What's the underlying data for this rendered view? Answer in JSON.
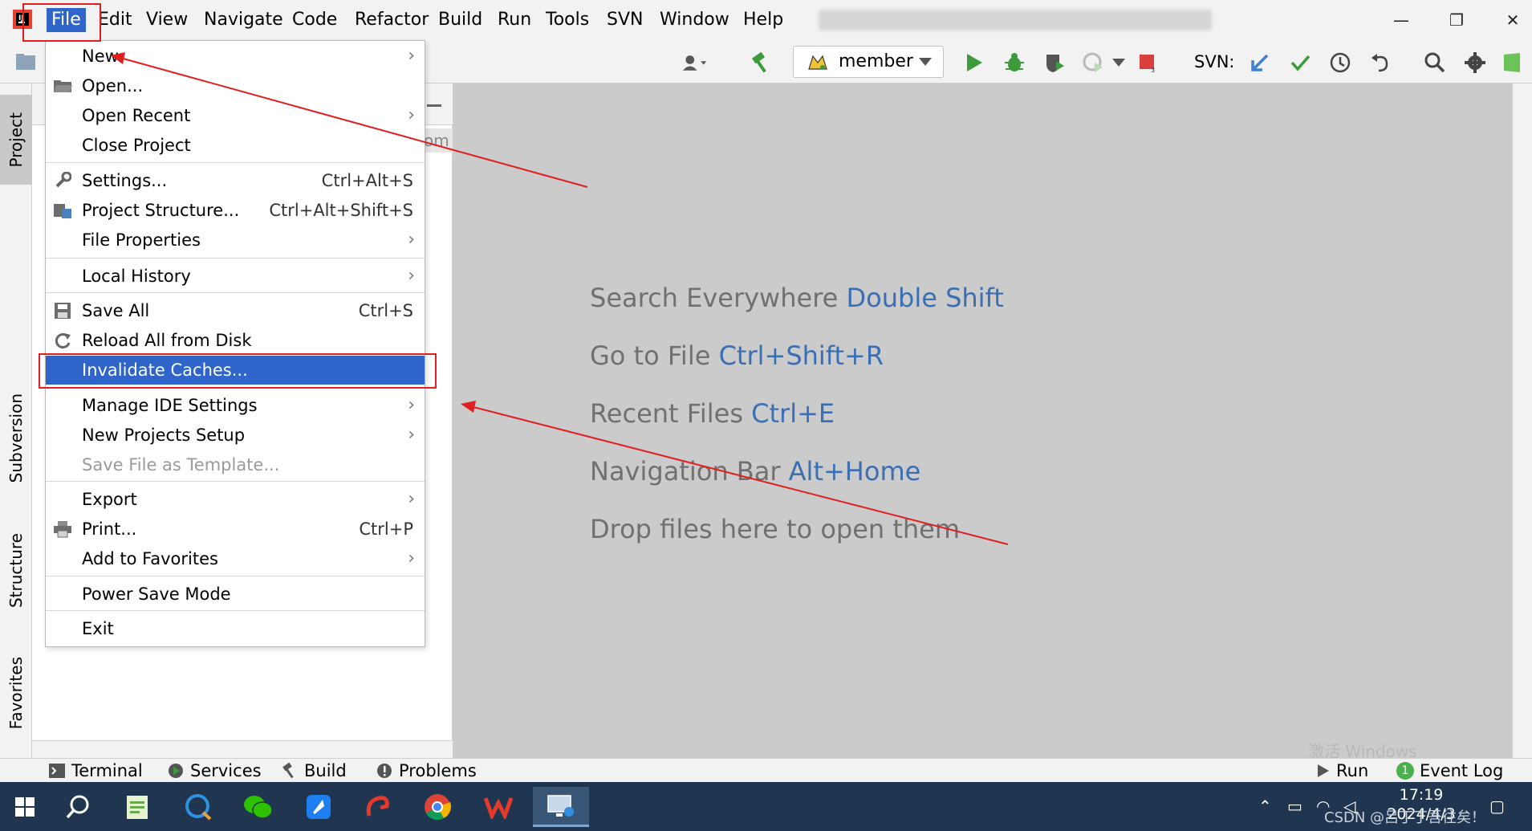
{
  "menubar": {
    "items": [
      "File",
      "Edit",
      "View",
      "Navigate",
      "Code",
      "Refactor",
      "Build",
      "Run",
      "Tools",
      "SVN",
      "Window",
      "Help"
    ],
    "window_controls": {
      "minimize": "—",
      "restore": "❐",
      "close": "✕"
    }
  },
  "toolbar": {
    "run_config_label": "member",
    "svn_label": "SVN:"
  },
  "left_stripe": {
    "tabs": [
      "Project",
      "Subversion",
      "Structure",
      "Favorites"
    ]
  },
  "file_menu": {
    "items": [
      {
        "label": "New",
        "shortcut": "",
        "submenu": true
      },
      {
        "label": "Open...",
        "shortcut": "",
        "submenu": false
      },
      {
        "label": "Open Recent",
        "shortcut": "",
        "submenu": true
      },
      {
        "label": "Close Project",
        "shortcut": "",
        "submenu": false
      },
      {
        "label": "Settings...",
        "shortcut": "Ctrl+Alt+S",
        "submenu": false
      },
      {
        "label": "Project Structure...",
        "shortcut": "Ctrl+Alt+Shift+S",
        "submenu": false
      },
      {
        "label": "File Properties",
        "shortcut": "",
        "submenu": true
      },
      {
        "label": "Local History",
        "shortcut": "",
        "submenu": true
      },
      {
        "label": "Save All",
        "shortcut": "Ctrl+S",
        "submenu": false
      },
      {
        "label": "Reload All from Disk",
        "shortcut": "",
        "submenu": false
      },
      {
        "label": "Invalidate Caches...",
        "shortcut": "",
        "submenu": false
      },
      {
        "label": "Manage IDE Settings",
        "shortcut": "",
        "submenu": true
      },
      {
        "label": "New Projects Setup",
        "shortcut": "",
        "submenu": true
      },
      {
        "label": "Save File as Template...",
        "shortcut": "",
        "submenu": false
      },
      {
        "label": "Export",
        "shortcut": "",
        "submenu": true
      },
      {
        "label": "Print...",
        "shortcut": "Ctrl+P",
        "submenu": false
      },
      {
        "label": "Add to Favorites",
        "shortcut": "",
        "submenu": true
      },
      {
        "label": "Power Save Mode",
        "shortcut": "",
        "submenu": false
      },
      {
        "label": "Exit",
        "shortcut": "",
        "submenu": false
      }
    ],
    "submenu_arrow": "›"
  },
  "editor": {
    "hints": [
      {
        "text": "Search Everywhere ",
        "key": "Double Shift"
      },
      {
        "text": "Go to File ",
        "key": "Ctrl+Shift+R"
      },
      {
        "text": "Recent Files ",
        "key": "Ctrl+E"
      },
      {
        "text": "Navigation Bar ",
        "key": "Alt+Home"
      },
      {
        "text": "Drop files here to open them",
        "key": ""
      }
    ],
    "partial_text": "om"
  },
  "bottombar": {
    "terminal": "Terminal",
    "services": "Services",
    "build": "Build",
    "problems": "Problems",
    "run": "Run",
    "event_log": "Event Log",
    "event_count": "1"
  },
  "watermark": "激活 Windows",
  "taskbar": {
    "time": "17:19",
    "date": "2024/4/3",
    "csdn": "CSDN @吕丁丁吾往矣！"
  },
  "colors": {
    "accent": "#2f65ca",
    "annotation_red": "#e02020",
    "editor_bg": "#cbcbcb",
    "hint_key": "#3a6fb3"
  }
}
